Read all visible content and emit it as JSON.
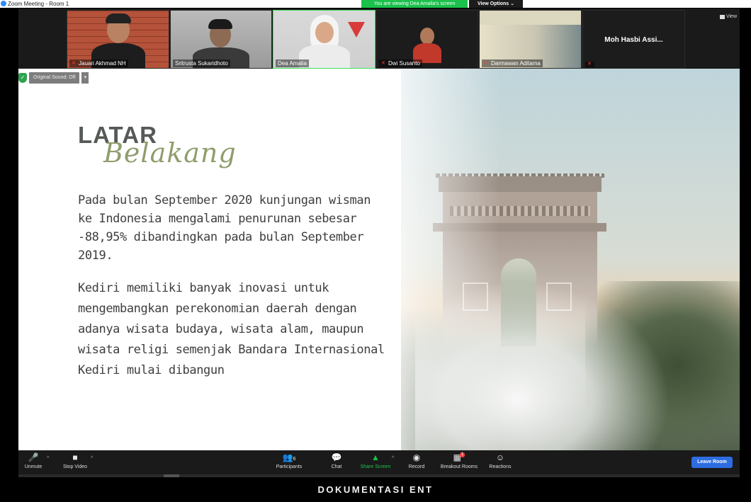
{
  "window": {
    "title": "Zoom Meeting - Room 1",
    "share_banner": "You are viewing Dea Amalia's screen",
    "view_options": "View Options ⌄"
  },
  "gallery": {
    "view_label": "View",
    "participants": [
      {
        "name": "Jauari Akhmad NH",
        "muted": true
      },
      {
        "name": "Sritrusta Sukaridhoto",
        "muted": false
      },
      {
        "name": "Dea Amalia",
        "muted": false,
        "active_speaker": true
      },
      {
        "name": "Dwi Susanto",
        "muted": true
      },
      {
        "name": "Darmawan Aditama",
        "muted": true
      },
      {
        "name": "Moh Hasbi Assi...",
        "muted": true,
        "video_off": true
      }
    ]
  },
  "audio_chip": {
    "label": "Original Sound: Off",
    "caret": "▾"
  },
  "slide": {
    "heading_main": "LATAR",
    "heading_script": "Belakang",
    "paragraph1": "Pada bulan September 2020 kunjungan wisman ke Indonesia mengalami penurunan sebesar -88,95% dibandingkan pada bulan September 2019.",
    "paragraph2": "Kediri memiliki banyak inovasi untuk mengembangkan perekonomian daerah dengan adanya wisata budaya, wisata alam, maupun wisata religi semenjak Bandara Internasional Kediri mulai dibangun"
  },
  "toolbar": {
    "unmute": "Unmute",
    "stop_video": "Stop Video",
    "participants": "Participants",
    "participants_count": "6",
    "chat": "Chat",
    "share_screen": "Share Screen",
    "record": "Record",
    "breakout_rooms": "Breakout Rooms",
    "breakout_badge": "1",
    "reactions": "Reactions",
    "leave_room": "Leave Room"
  },
  "caption": "DOKUMENTASI ENT",
  "colors": {
    "share_green": "#1ac14b",
    "leave_blue": "#2d6de0",
    "heading_gray": "#555a57",
    "script_green": "#8f9e6d",
    "muted_red": "#ff3b3b"
  }
}
